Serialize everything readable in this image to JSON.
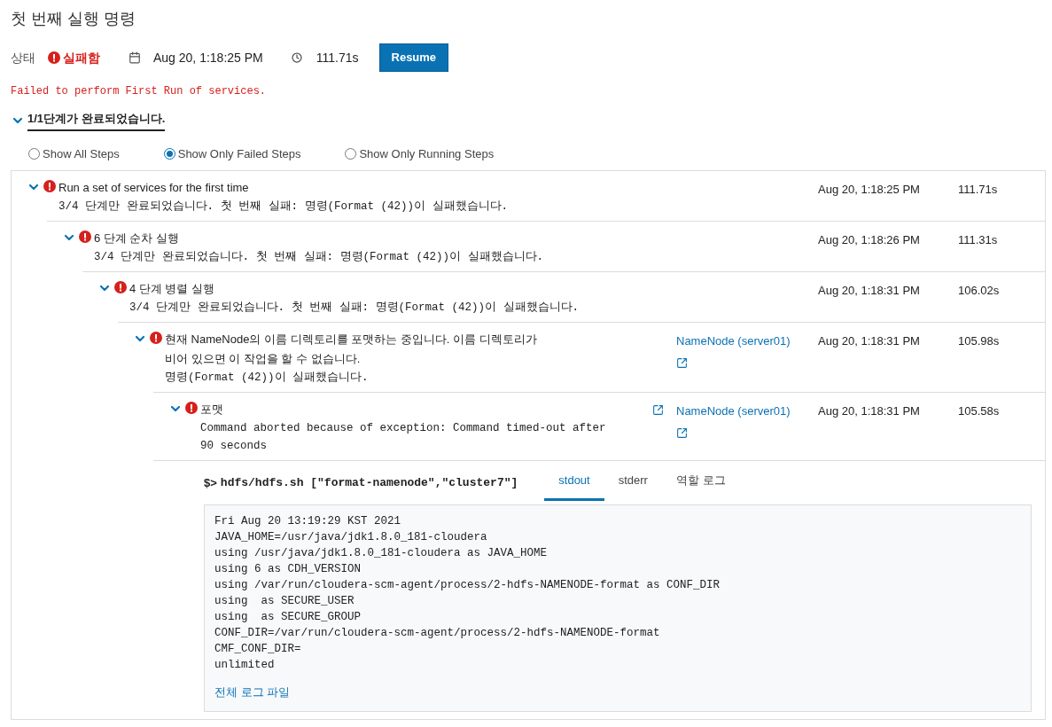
{
  "page": {
    "title": "첫 번째 실행 명령"
  },
  "summary": {
    "status_label": "상태",
    "status": "실패함",
    "kind": "failed",
    "started": "Aug 20, 1:18:25 PM",
    "duration": "111.71s",
    "resume_button": "Resume"
  },
  "error_message": "Failed to perform First Run of services.",
  "progress": {
    "text": "1/1단계가 완료되었습니다.",
    "expanded": true
  },
  "filters": [
    {
      "label": "Show All Steps",
      "selected": false
    },
    {
      "label": "Show Only Failed Steps",
      "selected": true
    },
    {
      "label": "Show Only Running Steps",
      "selected": false
    }
  ],
  "steps": [
    {
      "title": "Run a set of services for the first time",
      "message": "3/4 단계만 완료되었습니다. 첫 번째 실패: 명령(Format (42))이 실패했습니다.",
      "kind": "failed",
      "expanded": true,
      "time": "Aug 20, 1:18:25 PM",
      "duration": "111.71s",
      "children": [
        {
          "title": "6 단계 순차 실행",
          "message": "3/4 단계만 완료되었습니다. 첫 번째 실패: 명령(Format (42))이 실패했습니다.",
          "kind": "failed",
          "expanded": true,
          "time": "Aug 20, 1:18:26 PM",
          "duration": "111.31s",
          "children": [
            {
              "title": "4 단계 병렬 실행",
              "message": "3/4 단계만 완료되었습니다. 첫 번째 실패: 명령(Format (42))이 실패했습니다.",
              "kind": "failed",
              "expanded": true,
              "time": "Aug 20, 1:18:31 PM",
              "duration": "106.02s",
              "children": [
                {
                  "title": "현재 NameNode의 이름 디렉토리를 포맷하는 중입니다. 이름 디렉토리가 비어 있으면 이 작업을 할 수 없습니다.",
                  "message": "명령(Format (42))이 실패했습니다.",
                  "kind": "failed",
                  "expanded": true,
                  "role": "NameNode (server01)",
                  "time": "Aug 20, 1:18:31 PM",
                  "duration": "105.98s",
                  "children": [
                    {
                      "title": "포맷",
                      "message": "Command aborted because of exception: Command timed-out after 90 seconds",
                      "kind": "failed",
                      "expanded": true,
                      "role": "NameNode (server01)",
                      "time": "Aug 20, 1:18:31 PM",
                      "duration": "105.58s",
                      "log": {
                        "command": "hdfs/hdfs.sh [\"format-namenode\",\"cluster7\"]",
                        "prompt": "$>",
                        "tabs": [
                          {
                            "label": "stdout",
                            "selected": true
                          },
                          {
                            "label": "stderr",
                            "selected": false
                          },
                          {
                            "label": "역할 로그",
                            "selected": false
                          }
                        ],
                        "lines": [
                          "Fri Aug 20 13:19:29 KST 2021",
                          "JAVA_HOME=/usr/java/jdk1.8.0_181-cloudera",
                          "using /usr/java/jdk1.8.0_181-cloudera as JAVA_HOME",
                          "using 6 as CDH_VERSION",
                          "using /var/run/cloudera-scm-agent/process/2-hdfs-NAMENODE-format as CONF_DIR",
                          "using  as SECURE_USER",
                          "using  as SECURE_GROUP",
                          "CONF_DIR=/var/run/cloudera-scm-agent/process/2-hdfs-NAMENODE-format",
                          "CMF_CONF_DIR=",
                          "unlimited"
                        ],
                        "full_log_link": "전체 로그 파일"
                      }
                    }
                  ]
                }
              ]
            }
          ]
        }
      ]
    }
  ]
}
